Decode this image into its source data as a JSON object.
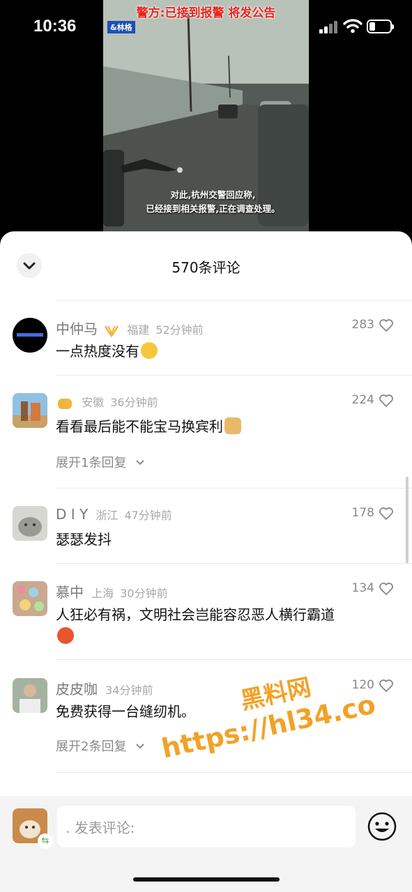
{
  "status_bar": {
    "time": "10:36"
  },
  "video": {
    "headline": "警方:已接到报警 将发公告",
    "logo": "&林格",
    "subtitle_line1": "对此,杭州交警回应称,",
    "subtitle_line2": "已经接到相关报警,正在调查处理。"
  },
  "sheet": {
    "title": "570条评论"
  },
  "comments": [
    {
      "username": "中仲马",
      "location": "福建",
      "time": "52分钟前",
      "text": "一点热度没有",
      "likes": "283",
      "emoji": "laugh-emoji"
    },
    {
      "username": "",
      "location": "安徽",
      "time": "36分钟前",
      "text": "看看最后能不能宝马换宾利",
      "likes": "224",
      "emoji": "dog-emoji",
      "expand": "展开1条回复"
    },
    {
      "username": "D I Y",
      "location": "浙江",
      "time": "47分钟前",
      "text": "瑟瑟发抖",
      "likes": "178"
    },
    {
      "username": "慕中",
      "location": "上海",
      "time": "30分钟前",
      "text": "人狂必有祸，文明社会岂能容忍恶人横行霸道",
      "likes": "134",
      "emoji": "angry-emoji"
    },
    {
      "username": "皮皮咖",
      "location": "",
      "time": "34分钟前",
      "text": "免费获得一台缝纫机。",
      "likes": "120",
      "expand": "展开2条回复"
    }
  ],
  "watermark": {
    "line1": "黑料网",
    "line2": "https://hl34.co"
  },
  "input": {
    "placeholder": ". 发表评论:"
  },
  "colors": {
    "accent_watermark": "#f39a14",
    "muted": "#a8a8a8"
  }
}
